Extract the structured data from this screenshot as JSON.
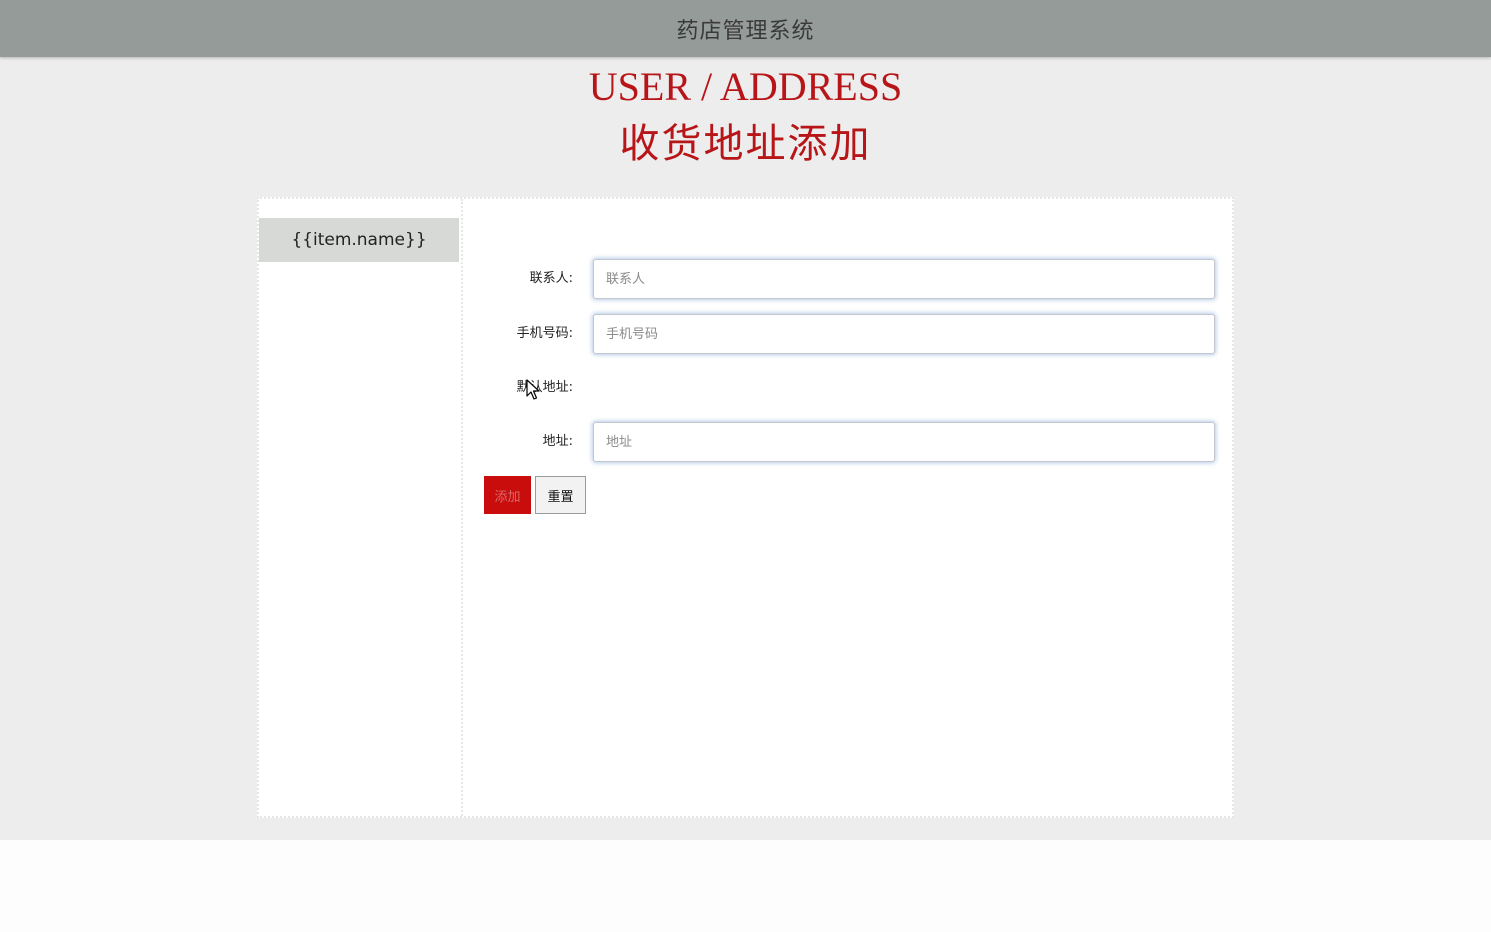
{
  "header": {
    "app_title": "药店管理系统"
  },
  "page": {
    "title_en": "USER / ADDRESS",
    "title_cn": "收货地址添加"
  },
  "sidebar": {
    "items": [
      {
        "label": "{{item.name}}"
      }
    ]
  },
  "form": {
    "contact": {
      "label": "联系人:",
      "placeholder": "联系人",
      "value": ""
    },
    "phone": {
      "label": "手机号码:",
      "placeholder": "手机号码",
      "value": ""
    },
    "default_address": {
      "label": "默认地址:"
    },
    "address": {
      "label": "地址:",
      "placeholder": "地址",
      "value": ""
    },
    "add_button": "添加",
    "reset_button": "重置"
  },
  "colors": {
    "accent": "#b81519",
    "button_primary": "#c90d0d",
    "header_bg": "#959b98"
  },
  "icons": {
    "cursor": "mouse-pointer-icon"
  }
}
